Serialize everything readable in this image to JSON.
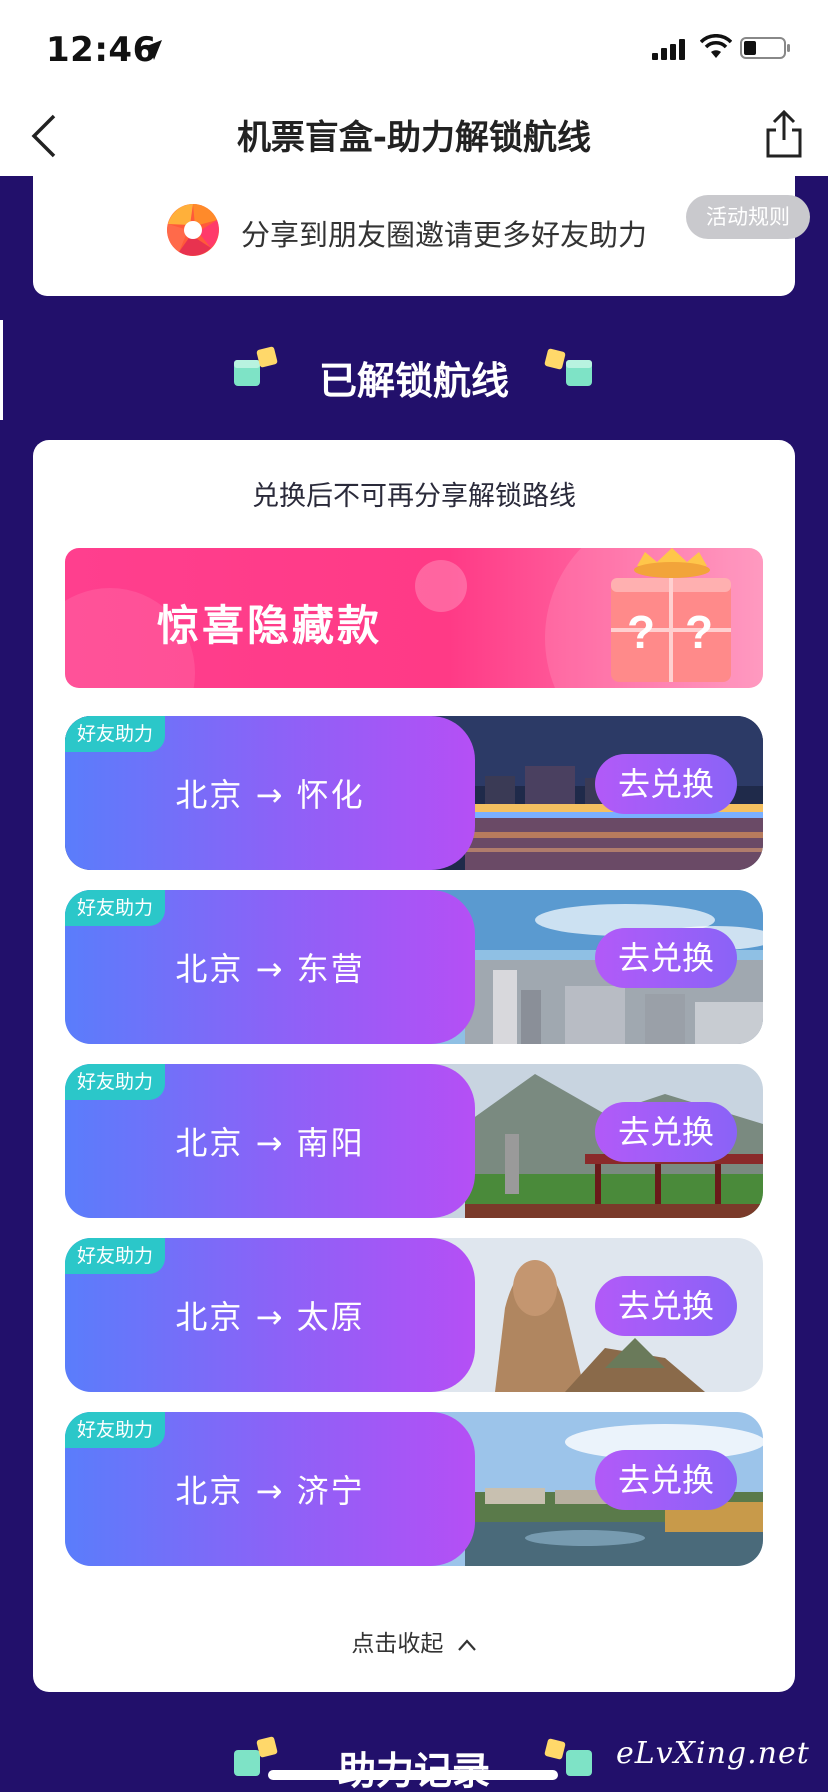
{
  "status_bar": {
    "time": "12:46"
  },
  "nav": {
    "title": "机票盲盒-助力解锁航线"
  },
  "invite": {
    "text": "分享到朋友圈邀请更多好友助力",
    "rules_label": "活动规则"
  },
  "unlocked_section": {
    "title": "已解锁航线"
  },
  "panel": {
    "note": "兑换后不可再分享解锁路线",
    "surprise_banner": {
      "title": "惊喜隐藏款"
    },
    "routes": [
      {
        "tag": "好友助力",
        "route": "北京 → 怀化",
        "button": "去兑换"
      },
      {
        "tag": "好友助力",
        "route": "北京 → 东营",
        "button": "去兑换"
      },
      {
        "tag": "好友助力",
        "route": "北京 → 南阳",
        "button": "去兑换"
      },
      {
        "tag": "好友助力",
        "route": "北京 → 太原",
        "button": "去兑换"
      },
      {
        "tag": "好友助力",
        "route": "北京 → 济宁",
        "button": "去兑换"
      }
    ],
    "collapse_label": "点击收起"
  },
  "records_section": {
    "title": "助力记录"
  },
  "watermark": "eLvXing.net",
  "colors": {
    "background": "#22106b",
    "route_gradient_start": "#5a7dfb",
    "route_gradient_end": "#b54ff5",
    "tag": "#2bc7c9",
    "banner": "#ff3f8e"
  }
}
